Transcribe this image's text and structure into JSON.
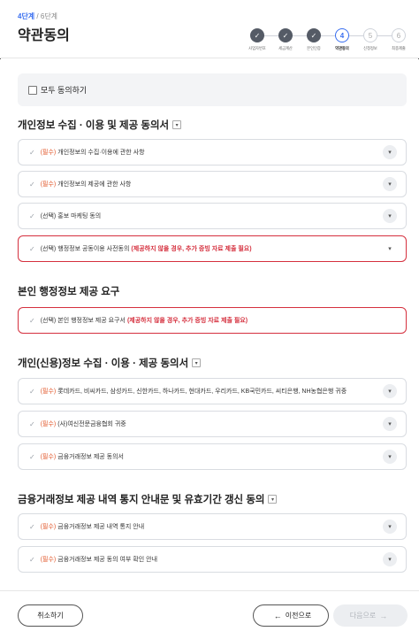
{
  "header": {
    "step_current": "4단계",
    "step_total": "6단계",
    "separator": "/",
    "title": "약관동의"
  },
  "stepper": {
    "steps": [
      {
        "symbol": "✓",
        "label": "사업자번호",
        "state": "done"
      },
      {
        "symbol": "✓",
        "label": "세금계산",
        "state": "done"
      },
      {
        "symbol": "✓",
        "label": "본인인증",
        "state": "done"
      },
      {
        "symbol": "4",
        "label": "약관동의",
        "state": "current"
      },
      {
        "symbol": "5",
        "label": "신청정보",
        "state": "todo"
      },
      {
        "symbol": "6",
        "label": "최종제출",
        "state": "todo"
      }
    ]
  },
  "all_agree": {
    "label": "모두 동의하기",
    "checked": false
  },
  "sections": [
    {
      "title": "개인정보 수집 · 이용 및 제공 동의서",
      "items": [
        {
          "tag": "(필수)",
          "text": "개인정보의 수집·이용에 관한 사항",
          "warning": ""
        },
        {
          "tag": "(필수)",
          "text": "개인정보의 제공에 관한 사항",
          "warning": ""
        },
        {
          "tag": "(선택)",
          "text": "홍보 마케팅 동의",
          "warning": ""
        },
        {
          "tag": "(선택)",
          "text": "행정정보 공동이용 사전동의",
          "warning": "(제공하지 않을 경우, 추가 증빙 자료 제출 필요)"
        }
      ]
    },
    {
      "title": "본인 행정정보 제공 요구",
      "items": [
        {
          "tag": "(선택)",
          "text": "본인 행정정보 제공 요구서",
          "warning": "(제공하지 않을 경우, 추가 증빙 자료 제출 필요)"
        }
      ]
    },
    {
      "title": "개인(신용)정보 수집 · 이용 · 제공 동의서",
      "items": [
        {
          "tag": "(필수)",
          "text": "롯데카드, 비씨카드, 삼성카드, 신한카드, 하나카드, 현대카드, 우리카드, KB국민카드, 씨티은행, NH농협은행 귀중",
          "warning": ""
        },
        {
          "tag": "(필수)",
          "text": "(사)여신전문금융협회 귀중",
          "warning": ""
        },
        {
          "tag": "(필수)",
          "text": "금융거래정보 제공 동의서",
          "warning": ""
        }
      ]
    },
    {
      "title": "금융거래정보 제공 내역 통지 안내문 및 유효기간 갱신 동의",
      "items": [
        {
          "tag": "(필수)",
          "text": "금융거래정보 제공 내역 통지 안내",
          "warning": ""
        },
        {
          "tag": "(필수)",
          "text": "금융거래정보 제공 동의 여부 확인 안내",
          "warning": ""
        }
      ]
    }
  ],
  "footer": {
    "cancel_label": "취소하기",
    "prev_label": "이전으로",
    "next_label": "다음으로"
  },
  "colors": {
    "accent": "#3a6ff0",
    "required": "#e2572a",
    "warning": "#d5303e",
    "done_step": "#555b66"
  }
}
